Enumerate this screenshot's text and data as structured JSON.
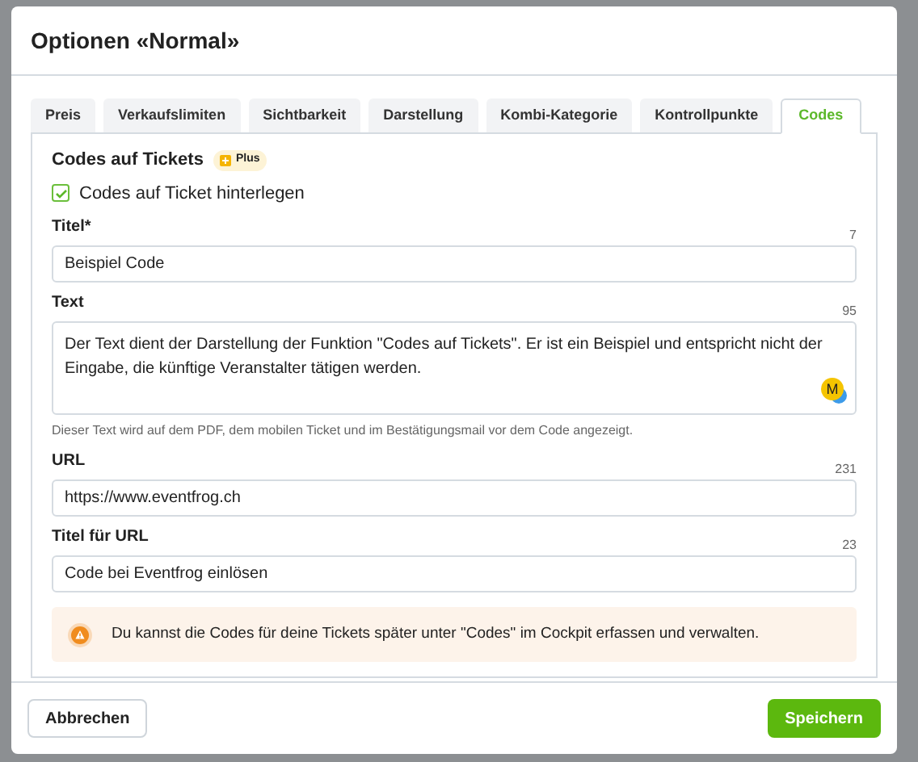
{
  "dialog": {
    "title": "Optionen «Normal»",
    "tabs": [
      {
        "label": "Preis",
        "selected": false
      },
      {
        "label": "Verkaufslimiten",
        "selected": false
      },
      {
        "label": "Sichtbarkeit",
        "selected": false
      },
      {
        "label": "Darstellung",
        "selected": false
      },
      {
        "label": "Kombi-Kategorie",
        "selected": false
      },
      {
        "label": "Kontrollpunkte",
        "selected": false
      },
      {
        "label": "Codes",
        "selected": true
      }
    ],
    "section": {
      "title": "Codes auf Tickets",
      "badge": "Plus",
      "checkbox": {
        "label": "Codes auf Ticket hinterlegen",
        "checked": true
      }
    },
    "fields": [
      {
        "kind": "input",
        "label": "Titel*",
        "counter": "7",
        "value": "Beispiel Code"
      },
      {
        "kind": "textarea",
        "label": "Text",
        "counter": "95",
        "value": "Der Text dient der Darstellung der Funktion \"Codes auf Tickets\". Er ist ein Beispiel und entspricht nicht der Eingabe, die künftige Veranstalter tätigen werden.",
        "badge": "M",
        "hint": "Dieser Text wird auf dem PDF, dem mobilen Ticket und im Bestätigungsmail vor dem Code angezeigt."
      },
      {
        "kind": "input",
        "label": "URL",
        "counter": "231",
        "value": "https://www.eventfrog.ch"
      },
      {
        "kind": "input",
        "label": "Titel für URL",
        "counter": "23",
        "value": "Code bei Eventfrog einlösen"
      }
    ],
    "notice": "Du kannst die Codes für deine Tickets später unter \"Codes\" im Cockpit erfassen und verwalten.",
    "buttons": {
      "cancel": "Abbrechen",
      "save": "Speichern"
    }
  }
}
